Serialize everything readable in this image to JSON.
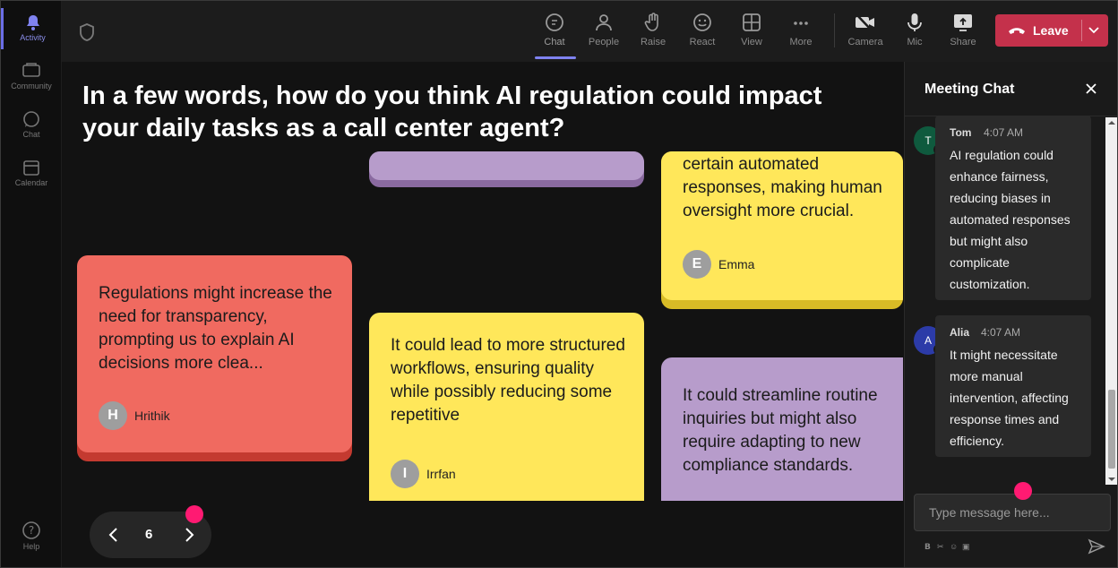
{
  "rail": {
    "items": [
      {
        "label": "Activity"
      },
      {
        "label": "Community"
      },
      {
        "label": "Chat"
      },
      {
        "label": "Calendar"
      },
      {
        "label": "Help"
      }
    ]
  },
  "toolbar": {
    "buttons": [
      {
        "label": "Chat"
      },
      {
        "label": "People"
      },
      {
        "label": "Raise"
      },
      {
        "label": "React"
      },
      {
        "label": "View"
      },
      {
        "label": "More"
      },
      {
        "label": "Camera"
      },
      {
        "label": "Mic"
      },
      {
        "label": "Share"
      }
    ],
    "leave_label": "Leave",
    "leave_color": "#c4314b"
  },
  "stage": {
    "question": "In a few words, how do you think AI regulation could impact your daily tasks as a call center agent?",
    "cards": [
      {
        "text": "",
        "author_initial": "",
        "author": "",
        "color": "#b79ccb"
      },
      {
        "text": "certain automated responses, making human oversight more crucial.",
        "author_initial": "E",
        "author": "Emma",
        "color": "#ffe75a"
      },
      {
        "text": "Regulations might increase the need for transparency, prompting us to explain AI decisions more clea...",
        "author_initial": "H",
        "author": "Hrithik",
        "color": "#f06a60"
      },
      {
        "text": "It could lead to more structured workflows, ensuring quality while possibly reducing some repetitive",
        "author_initial": "I",
        "author": "Irrfan",
        "color": "#ffe75a"
      },
      {
        "text": "It could streamline routine inquiries but might also require adapting to new compliance standards.",
        "author_initial": "",
        "author": "",
        "color": "#b79ccb"
      }
    ],
    "pager": {
      "page": "6"
    }
  },
  "chat": {
    "title": "Meeting Chat",
    "messages": [
      {
        "initial": "T",
        "name": "Tom",
        "time": "4:07 AM",
        "text": "AI regulation could enhance fairness, reducing biases in automated responses but might also complicate customization.",
        "avatar_color": "#0f5a3e"
      },
      {
        "initial": "A",
        "name": "Alia",
        "time": "4:07 AM",
        "text": "It might necessitate more manual intervention, affecting response times and efficiency.",
        "avatar_color": "#2c3ba8"
      }
    ],
    "input_placeholder": "Type message here...",
    "format_icons": [
      "bold-icon",
      "attach-icon",
      "emoji-icon",
      "gif-icon"
    ]
  }
}
